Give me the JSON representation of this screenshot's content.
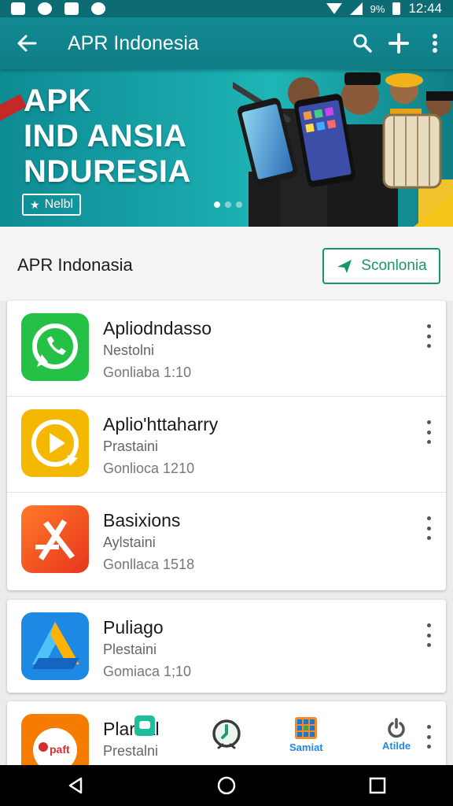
{
  "status_bar": {
    "battery_percent": "9%",
    "time": "12:44"
  },
  "toolbar": {
    "title": "APR Indonesia"
  },
  "banner": {
    "line1": "APK",
    "line2": "IND ANSIA",
    "line3": "NDURESIA",
    "button_label": "Nelbl",
    "slide_count": 3,
    "active_slide": 1
  },
  "section": {
    "title": "APR Indonasia",
    "button_label": "Sconlonia"
  },
  "apps": [
    {
      "name": "Apliodndasso",
      "subtitle": "Nestolni",
      "meta": "Gonliaba 1:10",
      "icon": "whatsapp-icon",
      "color": "#25c147"
    },
    {
      "name": "Aplio'httaharry",
      "subtitle": "Prastaini",
      "meta": "Gonlioca 1210",
      "icon": "play-refresh-icon",
      "color": "#f5b800"
    },
    {
      "name": "Basixions",
      "subtitle": "Aylstaini",
      "meta": "Gonllaca 1518",
      "icon": "x-logo-icon",
      "color": "#f04a1e"
    },
    {
      "name": "Puliago",
      "subtitle": "Plestaini",
      "meta": "Gomiaca 1;10",
      "icon": "drive-icon",
      "color": "#1e88e5"
    },
    {
      "name": "Plar fal",
      "subtitle": "Prestalni",
      "meta": "",
      "icon": "pay-icon",
      "color": "#f57c00",
      "icon_text": "paft"
    }
  ],
  "bottom_tabs": [
    {
      "label": "",
      "icon": "chat-icon"
    },
    {
      "label": "",
      "icon": "clock-icon"
    },
    {
      "label": "Samiat",
      "icon": "grid-icon",
      "color": "#1e88e5"
    },
    {
      "label": "Atilde",
      "icon": "power-icon",
      "color": "#1e88e5"
    }
  ]
}
